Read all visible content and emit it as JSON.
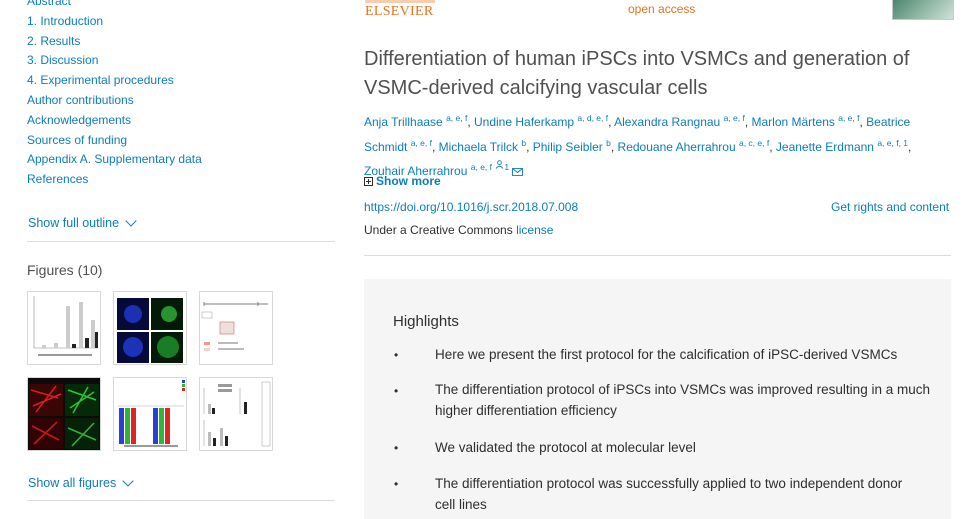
{
  "outline": {
    "items": [
      "Abstract",
      "1. Introduction",
      "2. Results",
      "3. Discussion",
      "4. Experimental procedures",
      "Author contributions",
      "Acknowledgements",
      "Sources of funding",
      "Appendix A. Supplementary data",
      "References"
    ],
    "show_full_outline": "Show full outline"
  },
  "figures": {
    "title": "Figures (10)",
    "show_all": "Show all figures"
  },
  "publisher": {
    "name": "ELSEVIER",
    "access": "open access"
  },
  "article": {
    "title": "Differentiation of human iPSCs into VSMCs and generation of VSMC-derived calcifying vascular cells",
    "authors": [
      {
        "name": "Anja Trillhaase",
        "sup": "a, e, f"
      },
      {
        "name": "Undine Haferkamp",
        "sup": "a, d, e, f"
      },
      {
        "name": "Alexandra Rangnau",
        "sup": "a, e, f"
      },
      {
        "name": "Marlon Märtens",
        "sup": "a, e, f"
      },
      {
        "name": "Beatrice Schmidt",
        "sup": "a, e, f"
      },
      {
        "name": "Michaela Trilck",
        "sup": "b"
      },
      {
        "name": "Philip Seibler",
        "sup": "b"
      },
      {
        "name": "Redouane Aherrahrou",
        "sup": "a, c, e, f"
      },
      {
        "name": "Jeanette Erdmann",
        "sup": "a, e, f, 1"
      },
      {
        "name": "Zouhair Aherrahrou",
        "sup": "a, e, f",
        "corresponding": "1"
      }
    ],
    "show_more": "Show more",
    "doi": "https://doi.org/10.1016/j.scr.2018.07.008",
    "rights": "Get rights and content",
    "license_prefix": "Under a Creative Commons ",
    "license_link": "license"
  },
  "highlights": {
    "title": "Highlights",
    "bullet": "•",
    "items": [
      "Here we present the first protocol for the calcification of iPSC-derived VSMCs",
      "The differentiation protocol of iPSCs into VSMCs was improved resulting in a much higher differentiation efficiency",
      "We validated the protocol at molecular level",
      "The differentiation protocol was successfully applied to two independent donor cell lines"
    ]
  },
  "colors": {
    "link": "#0c7dbb",
    "publisher_orange": "#e9711c",
    "text": "#2e2e2e",
    "highlight_bg": "#f5f5f5"
  },
  "icons": [
    "chevron-down-icon",
    "person-icon",
    "envelope-icon",
    "plus-box-icon"
  ]
}
